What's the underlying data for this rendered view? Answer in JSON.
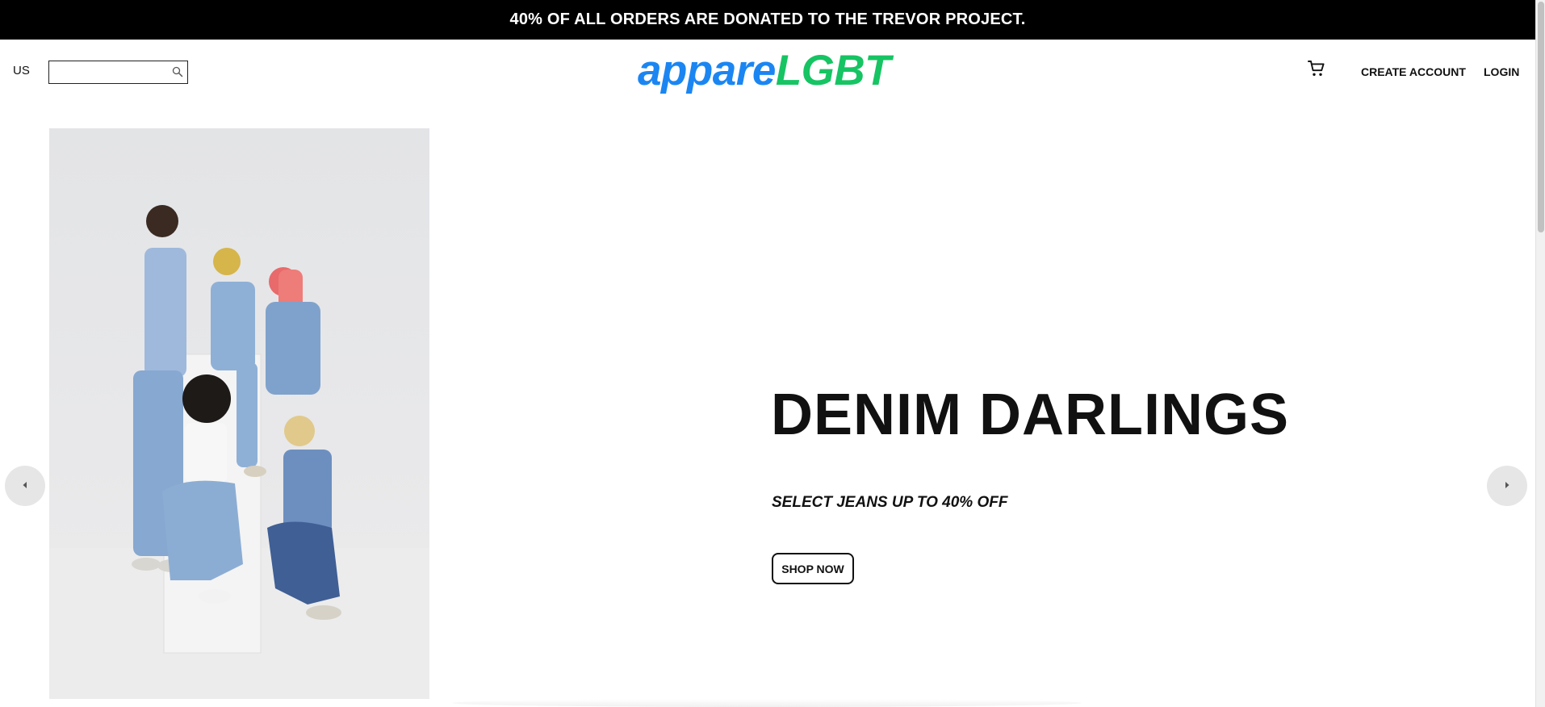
{
  "announcement": {
    "text": "40% OF ALL ORDERS ARE DONATED TO THE TREVOR PROJECT."
  },
  "header": {
    "locale": "US",
    "search": {
      "value": "",
      "placeholder": ""
    },
    "logo": {
      "part1": "appare",
      "part2": "LGBT"
    },
    "create_account_label": "CREATE ACCOUNT",
    "login_label": "LOGIN"
  },
  "icons": {
    "search": "search-icon",
    "cart": "cart-icon",
    "prev": "chevron-left-icon",
    "next": "chevron-right-icon"
  },
  "colors": {
    "announcement_bg": "#000000",
    "logo_blue": "#1b86f2",
    "logo_green": "#16c463",
    "arrow_bg": "#e6e6e6"
  },
  "hero": {
    "title": "DENIM DARLINGS",
    "subtitle": "SELECT JEANS UP TO 40% OFF",
    "cta_label": "SHOP NOW"
  }
}
